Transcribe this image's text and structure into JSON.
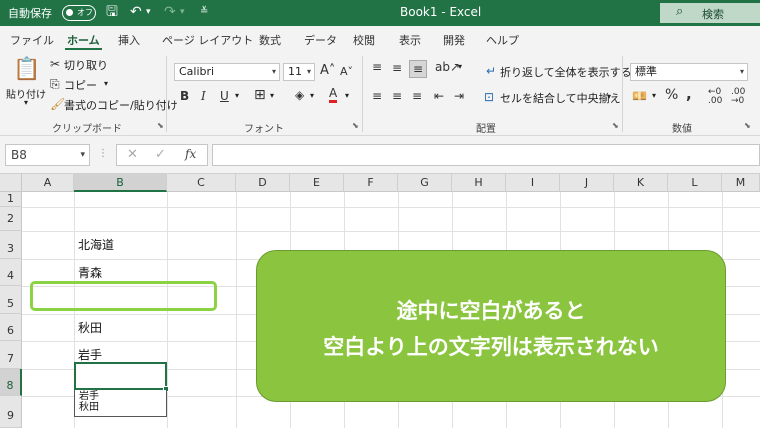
{
  "titlebar": {
    "autosave": "自動保存",
    "toggle": "オフ",
    "doc_title": "Book1  -  Excel",
    "search": "検索"
  },
  "tabs": [
    "ファイル",
    "ホーム",
    "挿入",
    "ページ レイアウト",
    "数式",
    "データ",
    "校閲",
    "表示",
    "開発",
    "ヘルプ"
  ],
  "active_tab": "ホーム",
  "ribbon": {
    "clipboard": {
      "paste": "貼り付け",
      "cut": "切り取り",
      "copy": "コピー",
      "format_painter": "書式のコピー/貼り付け",
      "label": "クリップボード"
    },
    "font": {
      "name": "Calibri",
      "size": "11",
      "label": "フォント"
    },
    "alignment": {
      "wrap": "折り返して全体を表示する",
      "merge": "セルを結合して中央揃え",
      "label": "配置"
    },
    "number": {
      "format": "標準",
      "label": "数値"
    }
  },
  "formula_bar": {
    "name_box": "B8",
    "fx": "fx"
  },
  "grid": {
    "columns": [
      "A",
      "B",
      "C",
      "D",
      "E",
      "F",
      "G",
      "H",
      "I",
      "J",
      "K",
      "L",
      "M"
    ],
    "rows": [
      "1",
      "2",
      "3",
      "4",
      "5",
      "6",
      "7",
      "8",
      "9"
    ],
    "selected_column": "B",
    "selected_row": "8",
    "cells": {
      "B3": "北海道",
      "B4": "青森",
      "B6": "秋田",
      "B7": "岩手"
    },
    "dropdown_list": [
      "岩手",
      "秋田"
    ]
  },
  "callout": {
    "line1": "途中に空白があると",
    "line2": "空白より上の文字列は表示されない"
  },
  "colors": {
    "excel_green": "#217346",
    "callout_green": "#8bc540",
    "highlight_border": "#8bd244"
  }
}
